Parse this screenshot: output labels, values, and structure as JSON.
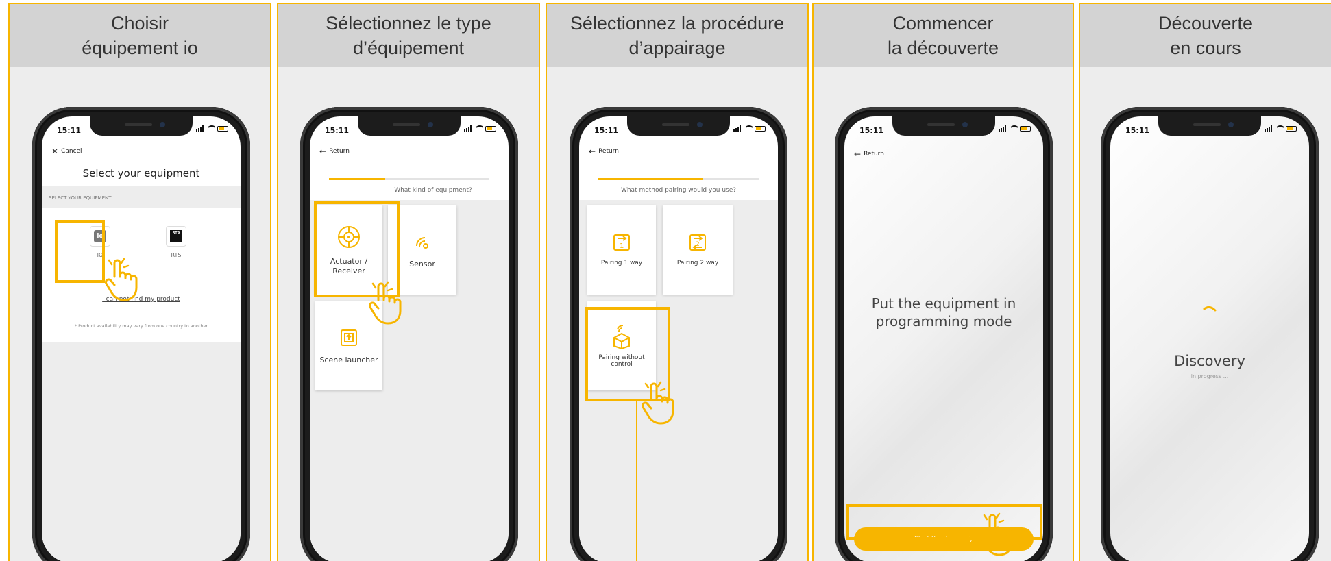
{
  "accent_color": "#F7B500",
  "panels": [
    {
      "title_line1": "Choisir",
      "title_line2": "équipement io"
    },
    {
      "title_line1": "Sélectionnez le type",
      "title_line2": "d’équipement"
    },
    {
      "title_line1": "Sélectionnez la procédure",
      "title_line2": "d’appairage"
    },
    {
      "title_line1": "Commencer",
      "title_line2": "la découverte"
    },
    {
      "title_line1": "Découverte",
      "title_line2": "en cours"
    }
  ],
  "status_time": "15:11",
  "screen1": {
    "cancel_label": "Cancel",
    "title": "Select your equipment",
    "section_label": "SELECT YOUR EQUIPMENT",
    "options": [
      {
        "label": "IO",
        "icon": "io-logo-icon"
      },
      {
        "label": "RTS",
        "icon": "rts-logo-icon"
      }
    ],
    "not_found_link": "I can not find my product",
    "footnote": "* Product availability may vary from one country to another"
  },
  "screen2": {
    "return_label": "Return",
    "progress": 0.35,
    "question": "What kind of equipment?",
    "cards": [
      {
        "label": "Actuator / Receiver",
        "icon": "actuator-icon"
      },
      {
        "label": "Sensor",
        "icon": "sensor-icon"
      },
      {
        "label": "Scene launcher",
        "icon": "scene-launcher-icon"
      }
    ]
  },
  "screen3": {
    "return_label": "Return",
    "progress": 0.65,
    "question": "What method pairing would you use?",
    "cards": [
      {
        "label": "Pairing 1 way",
        "icon": "pairing-1-way-icon"
      },
      {
        "label": "Pairing 2 way",
        "icon": "pairing-2-way-icon"
      },
      {
        "label": "Pairing without control",
        "icon": "pairing-without-control-icon"
      }
    ]
  },
  "screen4": {
    "return_label": "Return",
    "message": "Put the equipment in programming mode",
    "button_label": "Start the discovery"
  },
  "screen5": {
    "title": "Discovery",
    "subtitle": "in progress ..."
  }
}
